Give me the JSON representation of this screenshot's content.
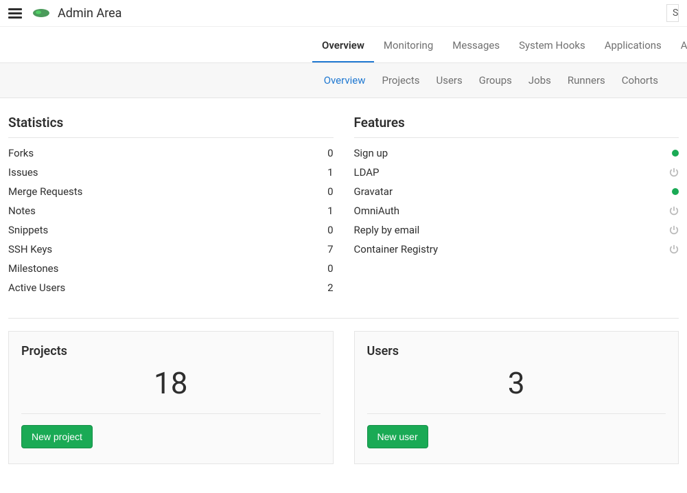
{
  "header": {
    "title": "Admin Area",
    "search_stub": "S"
  },
  "main_tabs": [
    {
      "label": "Overview",
      "active": true
    },
    {
      "label": "Monitoring",
      "active": false
    },
    {
      "label": "Messages",
      "active": false
    },
    {
      "label": "System Hooks",
      "active": false
    },
    {
      "label": "Applications",
      "active": false
    },
    {
      "label": "Abuse Reports",
      "active": false
    }
  ],
  "sub_tabs": [
    {
      "label": "Overview",
      "active": true
    },
    {
      "label": "Projects",
      "active": false
    },
    {
      "label": "Users",
      "active": false
    },
    {
      "label": "Groups",
      "active": false
    },
    {
      "label": "Jobs",
      "active": false
    },
    {
      "label": "Runners",
      "active": false
    },
    {
      "label": "Cohorts",
      "active": false
    }
  ],
  "statistics": {
    "heading": "Statistics",
    "items": [
      {
        "label": "Forks",
        "value": "0"
      },
      {
        "label": "Issues",
        "value": "1"
      },
      {
        "label": "Merge Requests",
        "value": "0"
      },
      {
        "label": "Notes",
        "value": "1"
      },
      {
        "label": "Snippets",
        "value": "0"
      },
      {
        "label": "SSH Keys",
        "value": "7"
      },
      {
        "label": "Milestones",
        "value": "0"
      },
      {
        "label": "Active Users",
        "value": "2"
      }
    ]
  },
  "features": {
    "heading": "Features",
    "items": [
      {
        "label": "Sign up",
        "enabled": true
      },
      {
        "label": "LDAP",
        "enabled": false
      },
      {
        "label": "Gravatar",
        "enabled": true
      },
      {
        "label": "OmniAuth",
        "enabled": false
      },
      {
        "label": "Reply by email",
        "enabled": false
      },
      {
        "label": "Container Registry",
        "enabled": false
      }
    ]
  },
  "cards": {
    "projects": {
      "heading": "Projects",
      "count": "18",
      "button": "New project"
    },
    "users": {
      "heading": "Users",
      "count": "3",
      "button": "New user"
    }
  }
}
